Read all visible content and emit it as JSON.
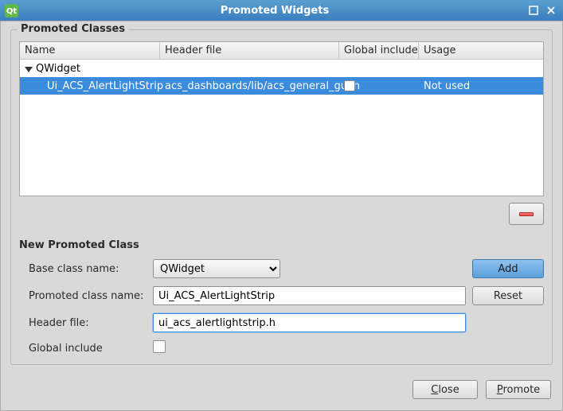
{
  "window": {
    "title": "Promoted Widgets"
  },
  "promoted_classes": {
    "group_title": "Promoted Classes",
    "columns": {
      "name": "Name",
      "header": "Header file",
      "global": "Global include",
      "usage": "Usage"
    },
    "parent": {
      "label": "QWidget"
    },
    "rows": [
      {
        "name": "Ui_ACS_AlertLightStrip",
        "header": "acs_dashboards/lib/acs_general_gui.h",
        "global_checked": false,
        "usage": "Not used"
      }
    ]
  },
  "new_class": {
    "section_title": "New Promoted Class",
    "labels": {
      "base": "Base class name:",
      "promoted": "Promoted class name:",
      "header": "Header file:",
      "global": "Global include"
    },
    "values": {
      "base": "QWidget",
      "promoted": "Ui_ACS_AlertLightStrip",
      "header": "ui_acs_alertlightstrip.h"
    },
    "buttons": {
      "add": "Add",
      "reset": "Reset"
    }
  },
  "footer": {
    "close_pre": "",
    "close_u": "C",
    "close_post": "lose",
    "promote_pre": "",
    "promote_u": "P",
    "promote_post": "romote"
  }
}
